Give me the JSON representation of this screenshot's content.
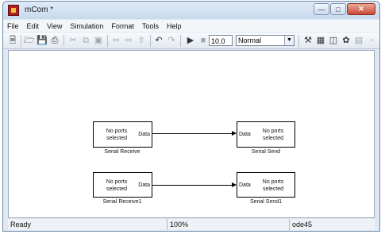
{
  "window": {
    "title": "mCom *"
  },
  "menubar": {
    "items": [
      "File",
      "Edit",
      "View",
      "Simulation",
      "Format",
      "Tools",
      "Help"
    ]
  },
  "toolbar": {
    "stop_time": "10.0",
    "sim_mode": "Normal"
  },
  "diagram": {
    "blocks": [
      {
        "label": "Serial Receive",
        "line1": "No ports",
        "line2": "selected",
        "port": "Data"
      },
      {
        "label": "Serial Send",
        "line1": "No ports",
        "line2": "selected",
        "port": "Data"
      },
      {
        "label": "Serial Receive1",
        "line1": "No ports",
        "line2": "selected",
        "port": "Data"
      },
      {
        "label": "Serial Send1",
        "line1": "No ports",
        "line2": "selected",
        "port": "Data"
      }
    ]
  },
  "status": {
    "state": "Ready",
    "zoom": "100%",
    "solver": "ode45"
  }
}
